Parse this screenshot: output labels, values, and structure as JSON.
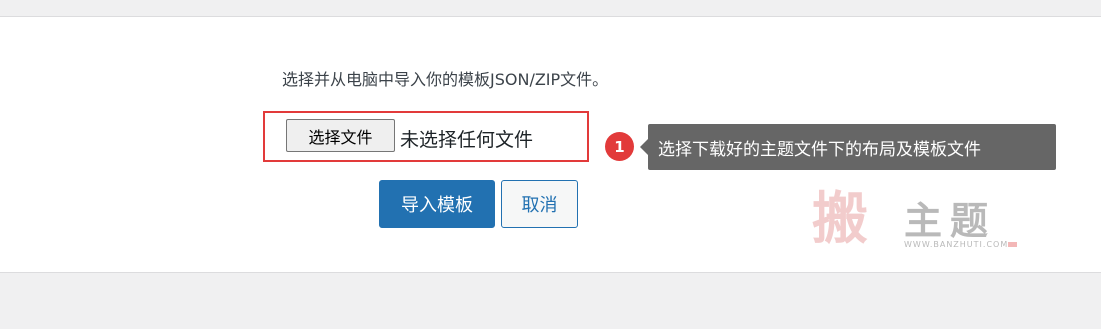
{
  "import": {
    "instruction": "选择并从电脑中导入你的模板JSON/ZIP文件。",
    "file_button_label": "选择文件",
    "file_status": "未选择任何文件",
    "import_button_label": "导入模板",
    "cancel_button_label": "取消"
  },
  "annotation": {
    "step_number": "1",
    "tooltip_text": "选择下载好的主题文件下的布局及模板文件"
  },
  "watermark": {
    "seal_text": "搬",
    "title": "主题",
    "url": "WWW.BANZHUTI.COM"
  },
  "colors": {
    "primary": "#2271b1",
    "highlight_red": "#e23a3a",
    "tooltip_bg": "#666666",
    "panel_bg": "#ffffff",
    "page_bg": "#f0f0f1"
  }
}
